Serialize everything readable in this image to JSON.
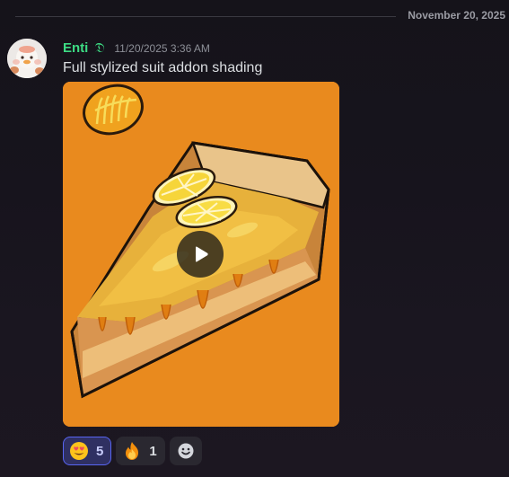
{
  "divider": {
    "date": "November 20, 2025"
  },
  "message": {
    "username": "Enti",
    "badge": "𝔇",
    "timestamp": "11/20/2025 3:36 AM",
    "text": "Full stylized suit addon shading",
    "attachment": {
      "type": "video",
      "icon": "play-icon"
    }
  },
  "reactions": [
    {
      "emoji": "smiling-face-with-heart-eyes",
      "count": "5",
      "active": true
    },
    {
      "emoji": "fire",
      "count": "1",
      "active": false
    }
  ],
  "add_reaction": {
    "icon": "add-reaction-icon"
  },
  "colors": {
    "username": "#3ddc84",
    "accent": "#5865f2",
    "video_bg": "#e98a1e"
  }
}
